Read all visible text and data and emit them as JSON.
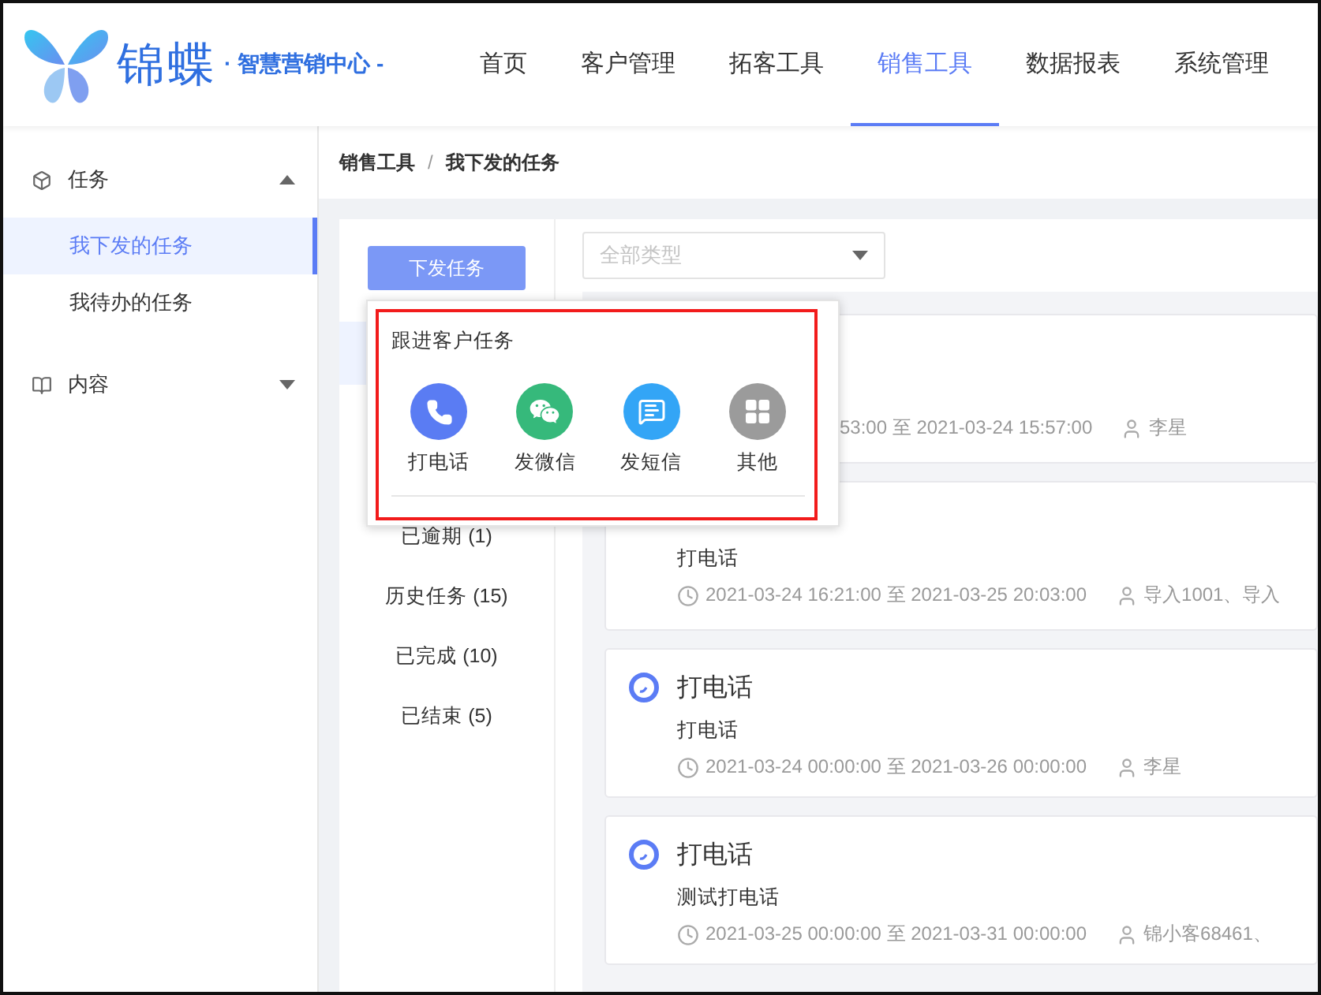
{
  "header": {
    "logo_text": "锦蝶",
    "logo_subtitle": "· 智慧营销中心 -",
    "nav": [
      {
        "label": "首页",
        "selected": false
      },
      {
        "label": "客户管理",
        "selected": false
      },
      {
        "label": "拓客工具",
        "selected": false
      },
      {
        "label": "销售工具",
        "selected": true
      },
      {
        "label": "数据报表",
        "selected": false
      },
      {
        "label": "系统管理",
        "selected": false
      }
    ]
  },
  "sidebar": {
    "groups": [
      {
        "label": "任务",
        "kind": "task",
        "expanded": true,
        "items": [
          {
            "label": "我下发的任务",
            "selected": true
          },
          {
            "label": "我待办的任务",
            "selected": false
          }
        ]
      },
      {
        "label": "内容",
        "kind": "content",
        "expanded": false
      }
    ]
  },
  "breadcrumb": {
    "items": [
      "销售工具",
      "我下发的任务"
    ],
    "separator": "/"
  },
  "issue_button": "下发任务",
  "status_filters": [
    "已逾期 (1)",
    "历史任务 (15)",
    "已完成 (10)",
    "已结束 (5)"
  ],
  "type_filter": {
    "placeholder": "全部类型"
  },
  "popup": {
    "title": "跟进客户任务",
    "options": [
      {
        "label": "打电话",
        "kind": "phone",
        "color": "#5a7cf3"
      },
      {
        "label": "发微信",
        "kind": "wechat",
        "color": "#36b97b"
      },
      {
        "label": "发短信",
        "kind": "sms",
        "color": "#33a5f6"
      },
      {
        "label": "其他",
        "kind": "other",
        "color": "#9b9b9b"
      }
    ]
  },
  "tasks": [
    {
      "time": "53:00 至 2021-03-24 15:57:00",
      "assignee": "李星"
    },
    {
      "description": "打电话",
      "time": "2021-03-24 16:21:00 至 2021-03-25 20:03:00",
      "assignee": "导入1001、导入"
    },
    {
      "title": "打电话",
      "description": "打电话",
      "time": "2021-03-24 00:00:00 至 2021-03-26 00:00:00",
      "assignee": "李星"
    },
    {
      "title": "打电话",
      "description": "测试打电话",
      "time": "2021-03-25 00:00:00 至 2021-03-31 00:00:00",
      "assignee": "锦小客68461、"
    }
  ]
}
